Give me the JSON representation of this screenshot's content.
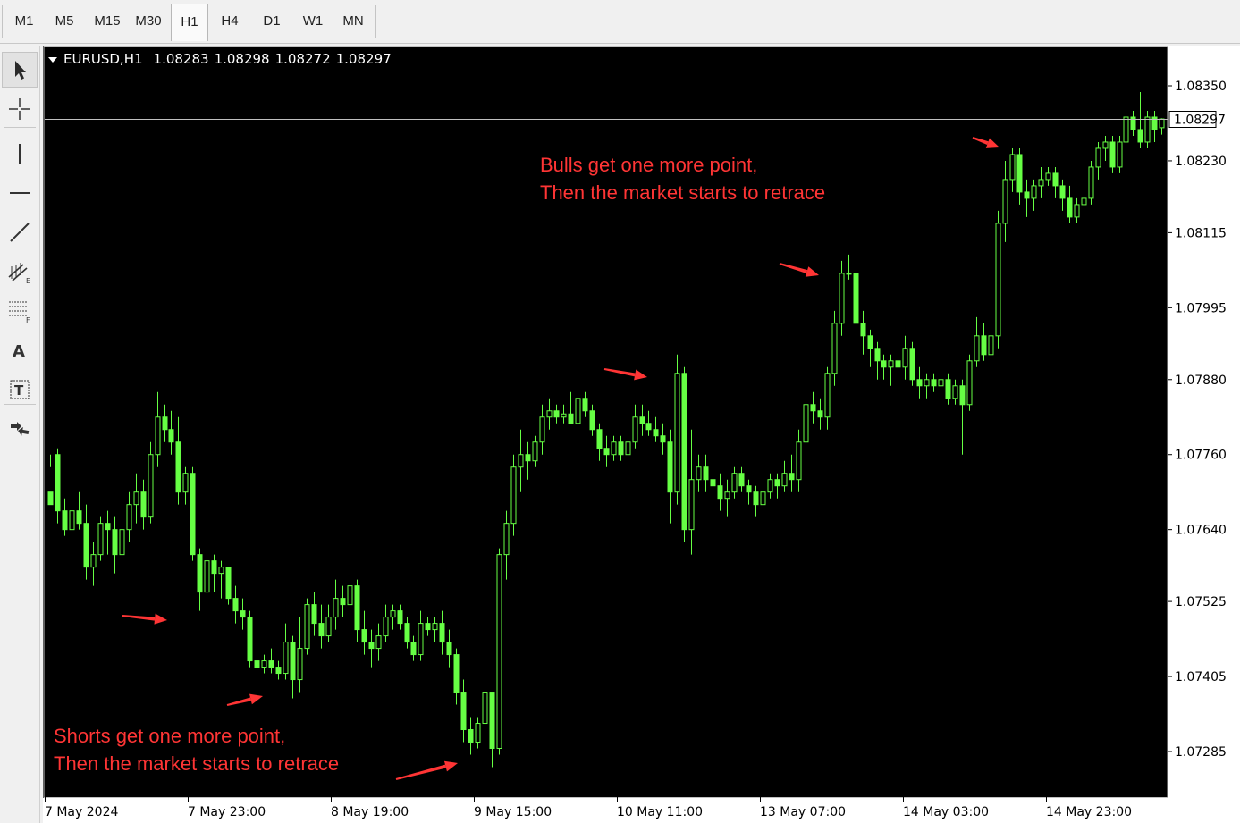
{
  "timeframes": [
    {
      "label": "M1",
      "active": false
    },
    {
      "label": "M5",
      "active": false
    },
    {
      "label": "M15",
      "active": false
    },
    {
      "label": "M30",
      "active": false
    },
    {
      "label": "H1",
      "active": true
    },
    {
      "label": "H4",
      "active": false
    },
    {
      "label": "D1",
      "active": false
    },
    {
      "label": "W1",
      "active": false
    },
    {
      "label": "MN",
      "active": false
    }
  ],
  "tools": [
    {
      "icon": "cursor-icon",
      "selected": true
    },
    {
      "icon": "crosshair-icon",
      "selected": false
    },
    {
      "icon": "vertical-line-icon",
      "selected": false
    },
    {
      "icon": "horizontal-line-icon",
      "selected": false
    },
    {
      "icon": "trendline-icon",
      "selected": false
    },
    {
      "icon": "equidistant-channel-icon",
      "selected": false
    },
    {
      "icon": "fibonacci-retracement-icon",
      "selected": false
    },
    {
      "icon": "text-icon",
      "selected": false
    },
    {
      "icon": "text-label-icon",
      "selected": false
    },
    {
      "icon": "arrows-icon",
      "selected": false
    }
  ],
  "symbol": {
    "name": "EURUSD,H1",
    "open": "1.08283",
    "high": "1.08298",
    "low": "1.08272",
    "close": "1.08297"
  },
  "annotations": {
    "bulls_line1": "Bulls get one more point,",
    "bulls_line2": "Then the market starts to retrace",
    "shorts_line1": "Shorts get one more point,",
    "shorts_line2": "Then the market starts to retrace"
  },
  "colors": {
    "background": "#000000",
    "candle": "#66ff44",
    "annotation": "#ff3535",
    "price_line": "#c0c0c0",
    "axis_text": "#ffffff"
  },
  "chart_data": {
    "type": "candlestick",
    "symbol": "EURUSD",
    "timeframe": "H1",
    "current_price": 1.08297,
    "ylim": [
      1.0723,
      1.084
    ],
    "price_ticks": [
      "1.08350",
      "1.08230",
      "1.08115",
      "1.07995",
      "1.07880",
      "1.07760",
      "1.07640",
      "1.07525",
      "1.07405",
      "1.07285"
    ],
    "time_ticks": [
      "7 May 2024",
      "7 May 23:00",
      "8 May 19:00",
      "9 May 15:00",
      "10 May 11:00",
      "13 May 07:00",
      "14 May 03:00",
      "14 May 23:00"
    ],
    "candles": [
      [
        1.077,
        1.0776,
        1.0774,
        1.0768
      ],
      [
        1.0776,
        1.0777,
        1.0765,
        1.0767
      ],
      [
        1.0767,
        1.0769,
        1.0763,
        1.0764
      ],
      [
        1.0764,
        1.0768,
        1.0762,
        1.0767
      ],
      [
        1.0767,
        1.077,
        1.0764,
        1.0765
      ],
      [
        1.0765,
        1.0768,
        1.0756,
        1.0758
      ],
      [
        1.0758,
        1.0762,
        1.0755,
        1.076
      ],
      [
        1.076,
        1.0766,
        1.0759,
        1.0765
      ],
      [
        1.0765,
        1.0767,
        1.076,
        1.0764
      ],
      [
        1.0764,
        1.0766,
        1.0757,
        1.076
      ],
      [
        1.076,
        1.0765,
        1.0758,
        1.0764
      ],
      [
        1.0764,
        1.077,
        1.0762,
        1.0768
      ],
      [
        1.0768,
        1.0773,
        1.0765,
        1.077
      ],
      [
        1.077,
        1.0772,
        1.0764,
        1.0766
      ],
      [
        1.0766,
        1.0778,
        1.0765,
        1.0776
      ],
      [
        1.0776,
        1.0786,
        1.0774,
        1.0782
      ],
      [
        1.0782,
        1.0784,
        1.0778,
        1.078
      ],
      [
        1.078,
        1.0783,
        1.0776,
        1.0778
      ],
      [
        1.0778,
        1.0782,
        1.0768,
        1.077
      ],
      [
        1.077,
        1.0774,
        1.0768,
        1.0773
      ],
      [
        1.0773,
        1.0774,
        1.0759,
        1.076
      ],
      [
        1.076,
        1.0761,
        1.0751,
        1.0754
      ],
      [
        1.0754,
        1.076,
        1.0752,
        1.0759
      ],
      [
        1.0759,
        1.076,
        1.0754,
        1.0757
      ],
      [
        1.0757,
        1.0759,
        1.0753,
        1.0758
      ],
      [
        1.0758,
        1.0758,
        1.0752,
        1.0753
      ],
      [
        1.0753,
        1.0755,
        1.0749,
        1.0751
      ],
      [
        1.0751,
        1.0753,
        1.0748,
        1.075
      ],
      [
        1.075,
        1.0751,
        1.0742,
        1.0743
      ],
      [
        1.0743,
        1.0745,
        1.074,
        1.0742
      ],
      [
        1.0742,
        1.0744,
        1.0741,
        1.0743
      ],
      [
        1.0743,
        1.0745,
        1.0741,
        1.0742
      ],
      [
        1.0742,
        1.0743,
        1.074,
        1.0741
      ],
      [
        1.0741,
        1.0749,
        1.074,
        1.0746
      ],
      [
        1.0746,
        1.0747,
        1.0737,
        1.074
      ],
      [
        1.074,
        1.075,
        1.0738,
        1.0745
      ],
      [
        1.0745,
        1.0753,
        1.0744,
        1.0752
      ],
      [
        1.0752,
        1.0754,
        1.0747,
        1.0749
      ],
      [
        1.0749,
        1.0752,
        1.0745,
        1.0747
      ],
      [
        1.0747,
        1.0752,
        1.0746,
        1.075
      ],
      [
        1.075,
        1.0756,
        1.0748,
        1.0753
      ],
      [
        1.0753,
        1.0755,
        1.075,
        1.0752
      ],
      [
        1.0752,
        1.0758,
        1.075,
        1.0755
      ],
      [
        1.0755,
        1.0756,
        1.0746,
        1.0748
      ],
      [
        1.0748,
        1.0751,
        1.0744,
        1.0746
      ],
      [
        1.0746,
        1.0748,
        1.0742,
        1.0745
      ],
      [
        1.0745,
        1.0749,
        1.0743,
        1.0747
      ],
      [
        1.0747,
        1.0752,
        1.0746,
        1.075
      ],
      [
        1.075,
        1.0752,
        1.0748,
        1.0751
      ],
      [
        1.0751,
        1.0752,
        1.0748,
        1.0749
      ],
      [
        1.0749,
        1.075,
        1.0745,
        1.0746
      ],
      [
        1.0746,
        1.0747,
        1.0743,
        1.0744
      ],
      [
        1.0744,
        1.0751,
        1.0743,
        1.0749
      ],
      [
        1.0749,
        1.075,
        1.0747,
        1.0748
      ],
      [
        1.0748,
        1.075,
        1.0746,
        1.0749
      ],
      [
        1.0749,
        1.0751,
        1.0744,
        1.0746
      ],
      [
        1.0746,
        1.0748,
        1.0742,
        1.0744
      ],
      [
        1.0744,
        1.0745,
        1.0736,
        1.0738
      ],
      [
        1.0738,
        1.074,
        1.073,
        1.0732
      ],
      [
        1.0732,
        1.0734,
        1.0728,
        1.073
      ],
      [
        1.073,
        1.0734,
        1.0729,
        1.0733
      ],
      [
        1.0733,
        1.074,
        1.0728,
        1.0738
      ],
      [
        1.0738,
        1.0738,
        1.0726,
        1.0729
      ],
      [
        1.0729,
        1.0761,
        1.0728,
        1.076
      ],
      [
        1.076,
        1.0767,
        1.0756,
        1.0765
      ],
      [
        1.0765,
        1.0776,
        1.0763,
        1.0774
      ],
      [
        1.0774,
        1.078,
        1.077,
        1.0776
      ],
      [
        1.0776,
        1.0778,
        1.0772,
        1.0775
      ],
      [
        1.0775,
        1.0779,
        1.0774,
        1.0778
      ],
      [
        1.0778,
        1.0784,
        1.0776,
        1.0782
      ],
      [
        1.0782,
        1.0785,
        1.078,
        1.0783
      ],
      [
        1.0783,
        1.0784,
        1.0781,
        1.0782
      ],
      [
        1.0782,
        1.0784,
        1.0781,
        1.07825
      ],
      [
        1.07825,
        1.0786,
        1.0781,
        1.0781
      ],
      [
        1.0781,
        1.0786,
        1.078,
        1.0785
      ],
      [
        1.0785,
        1.0786,
        1.0782,
        1.0783
      ],
      [
        1.0783,
        1.0784,
        1.0779,
        1.078
      ],
      [
        1.078,
        1.0781,
        1.0775,
        1.0777
      ],
      [
        1.0777,
        1.0779,
        1.0774,
        1.0776
      ],
      [
        1.0776,
        1.0779,
        1.0775,
        1.0778
      ],
      [
        1.0778,
        1.0779,
        1.0775,
        1.0776
      ],
      [
        1.0776,
        1.0779,
        1.0775,
        1.0778
      ],
      [
        1.0778,
        1.0784,
        1.0777,
        1.0782
      ],
      [
        1.0782,
        1.0784,
        1.0779,
        1.0781
      ],
      [
        1.0781,
        1.0783,
        1.0779,
        1.078
      ],
      [
        1.078,
        1.0782,
        1.0778,
        1.0779
      ],
      [
        1.0779,
        1.0781,
        1.0776,
        1.0778
      ],
      [
        1.0778,
        1.078,
        1.0765,
        1.077
      ],
      [
        1.077,
        1.0792,
        1.0768,
        1.0789
      ],
      [
        1.0789,
        1.079,
        1.0762,
        1.0764
      ],
      [
        1.0764,
        1.078,
        1.076,
        1.0772
      ],
      [
        1.0772,
        1.0776,
        1.077,
        1.0774
      ],
      [
        1.0774,
        1.0776,
        1.077,
        1.0772
      ],
      [
        1.0772,
        1.0774,
        1.0769,
        1.0771
      ],
      [
        1.0771,
        1.0773,
        1.0767,
        1.0769
      ],
      [
        1.0769,
        1.0772,
        1.0766,
        1.077
      ],
      [
        1.077,
        1.0774,
        1.0769,
        1.0773
      ],
      [
        1.0773,
        1.0774,
        1.077,
        1.0771
      ],
      [
        1.0771,
        1.0772,
        1.0768,
        1.077
      ],
      [
        1.077,
        1.0771,
        1.0766,
        1.0768
      ],
      [
        1.0768,
        1.0771,
        1.0767,
        1.077
      ],
      [
        1.077,
        1.0773,
        1.0769,
        1.0772
      ],
      [
        1.0772,
        1.0773,
        1.0769,
        1.0771
      ],
      [
        1.0771,
        1.0775,
        1.077,
        1.0773
      ],
      [
        1.0773,
        1.0776,
        1.077,
        1.0772
      ],
      [
        1.0772,
        1.078,
        1.077,
        1.0778
      ],
      [
        1.0778,
        1.0785,
        1.0776,
        1.0784
      ],
      [
        1.0784,
        1.0786,
        1.0781,
        1.0783
      ],
      [
        1.0783,
        1.0785,
        1.078,
        1.0782
      ],
      [
        1.0782,
        1.079,
        1.078,
        1.0789
      ],
      [
        1.0789,
        1.0799,
        1.0787,
        1.0797
      ],
      [
        1.0797,
        1.0807,
        1.0795,
        1.0805
      ],
      [
        1.0805,
        1.0808,
        1.0804,
        1.0805
      ],
      [
        1.0805,
        1.0806,
        1.0795,
        1.0797
      ],
      [
        1.0797,
        1.0799,
        1.0792,
        1.0795
      ],
      [
        1.0795,
        1.0796,
        1.079,
        1.0793
      ],
      [
        1.0793,
        1.0794,
        1.0788,
        1.0791
      ],
      [
        1.0791,
        1.0792,
        1.0788,
        1.079
      ],
      [
        1.079,
        1.0792,
        1.0787,
        1.0791
      ],
      [
        1.0791,
        1.0793,
        1.0789,
        1.079
      ],
      [
        1.079,
        1.0795,
        1.0788,
        1.0793
      ],
      [
        1.0793,
        1.0794,
        1.0787,
        1.0788
      ],
      [
        1.0788,
        1.079,
        1.0785,
        1.0787
      ],
      [
        1.0787,
        1.0789,
        1.0785,
        1.0788
      ],
      [
        1.0788,
        1.0789,
        1.0786,
        1.0787
      ],
      [
        1.0787,
        1.079,
        1.0785,
        1.0788
      ],
      [
        1.0788,
        1.0789,
        1.0784,
        1.0785
      ],
      [
        1.0785,
        1.0788,
        1.0784,
        1.0787
      ],
      [
        1.0787,
        1.0788,
        1.0776,
        1.0784
      ],
      [
        1.0784,
        1.0792,
        1.0783,
        1.0791
      ],
      [
        1.0791,
        1.0798,
        1.079,
        1.0795
      ],
      [
        1.0795,
        1.0797,
        1.0791,
        1.0792
      ],
      [
        1.0792,
        1.0796,
        1.0767,
        1.0795
      ],
      [
        1.0795,
        1.0815,
        1.0793,
        1.0813
      ],
      [
        1.0813,
        1.0823,
        1.081,
        1.082
      ],
      [
        1.082,
        1.0825,
        1.0818,
        1.0824
      ],
      [
        1.0824,
        1.0825,
        1.0816,
        1.0818
      ],
      [
        1.0818,
        1.082,
        1.0814,
        1.0817
      ],
      [
        1.0817,
        1.082,
        1.0815,
        1.0819
      ],
      [
        1.0819,
        1.0822,
        1.0817,
        1.082
      ],
      [
        1.082,
        1.0822,
        1.0819,
        1.0821
      ],
      [
        1.0821,
        1.0822,
        1.0817,
        1.0819
      ],
      [
        1.0819,
        1.082,
        1.0815,
        1.0817
      ],
      [
        1.0817,
        1.0819,
        1.0813,
        1.0814
      ],
      [
        1.0814,
        1.0817,
        1.0813,
        1.0816
      ],
      [
        1.0816,
        1.0819,
        1.0815,
        1.0817
      ],
      [
        1.0817,
        1.0823,
        1.0816,
        1.0822
      ],
      [
        1.0822,
        1.0826,
        1.082,
        1.0825
      ],
      [
        1.0825,
        1.0827,
        1.0823,
        1.0826
      ],
      [
        1.0826,
        1.0827,
        1.0821,
        1.0822
      ],
      [
        1.0822,
        1.0827,
        1.0821,
        1.0826
      ],
      [
        1.0826,
        1.0831,
        1.0824,
        1.083
      ],
      [
        1.083,
        1.0831,
        1.0827,
        1.0828
      ],
      [
        1.0828,
        1.0834,
        1.0825,
        1.0826
      ],
      [
        1.0826,
        1.0831,
        1.0825,
        1.083
      ],
      [
        1.083,
        1.0831,
        1.0826,
        1.0828
      ],
      [
        1.08283,
        1.08298,
        1.08272,
        1.08297
      ]
    ],
    "annotation_arrows": [
      {
        "candle_index": 21,
        "side": "left"
      },
      {
        "candle_index": 34,
        "side": "left"
      },
      {
        "candle_index": 62,
        "side": "left"
      },
      {
        "candle_index": 87,
        "side": "left"
      },
      {
        "candle_index": 112,
        "side": "left"
      },
      {
        "candle_index": 137,
        "side": "left"
      }
    ]
  }
}
